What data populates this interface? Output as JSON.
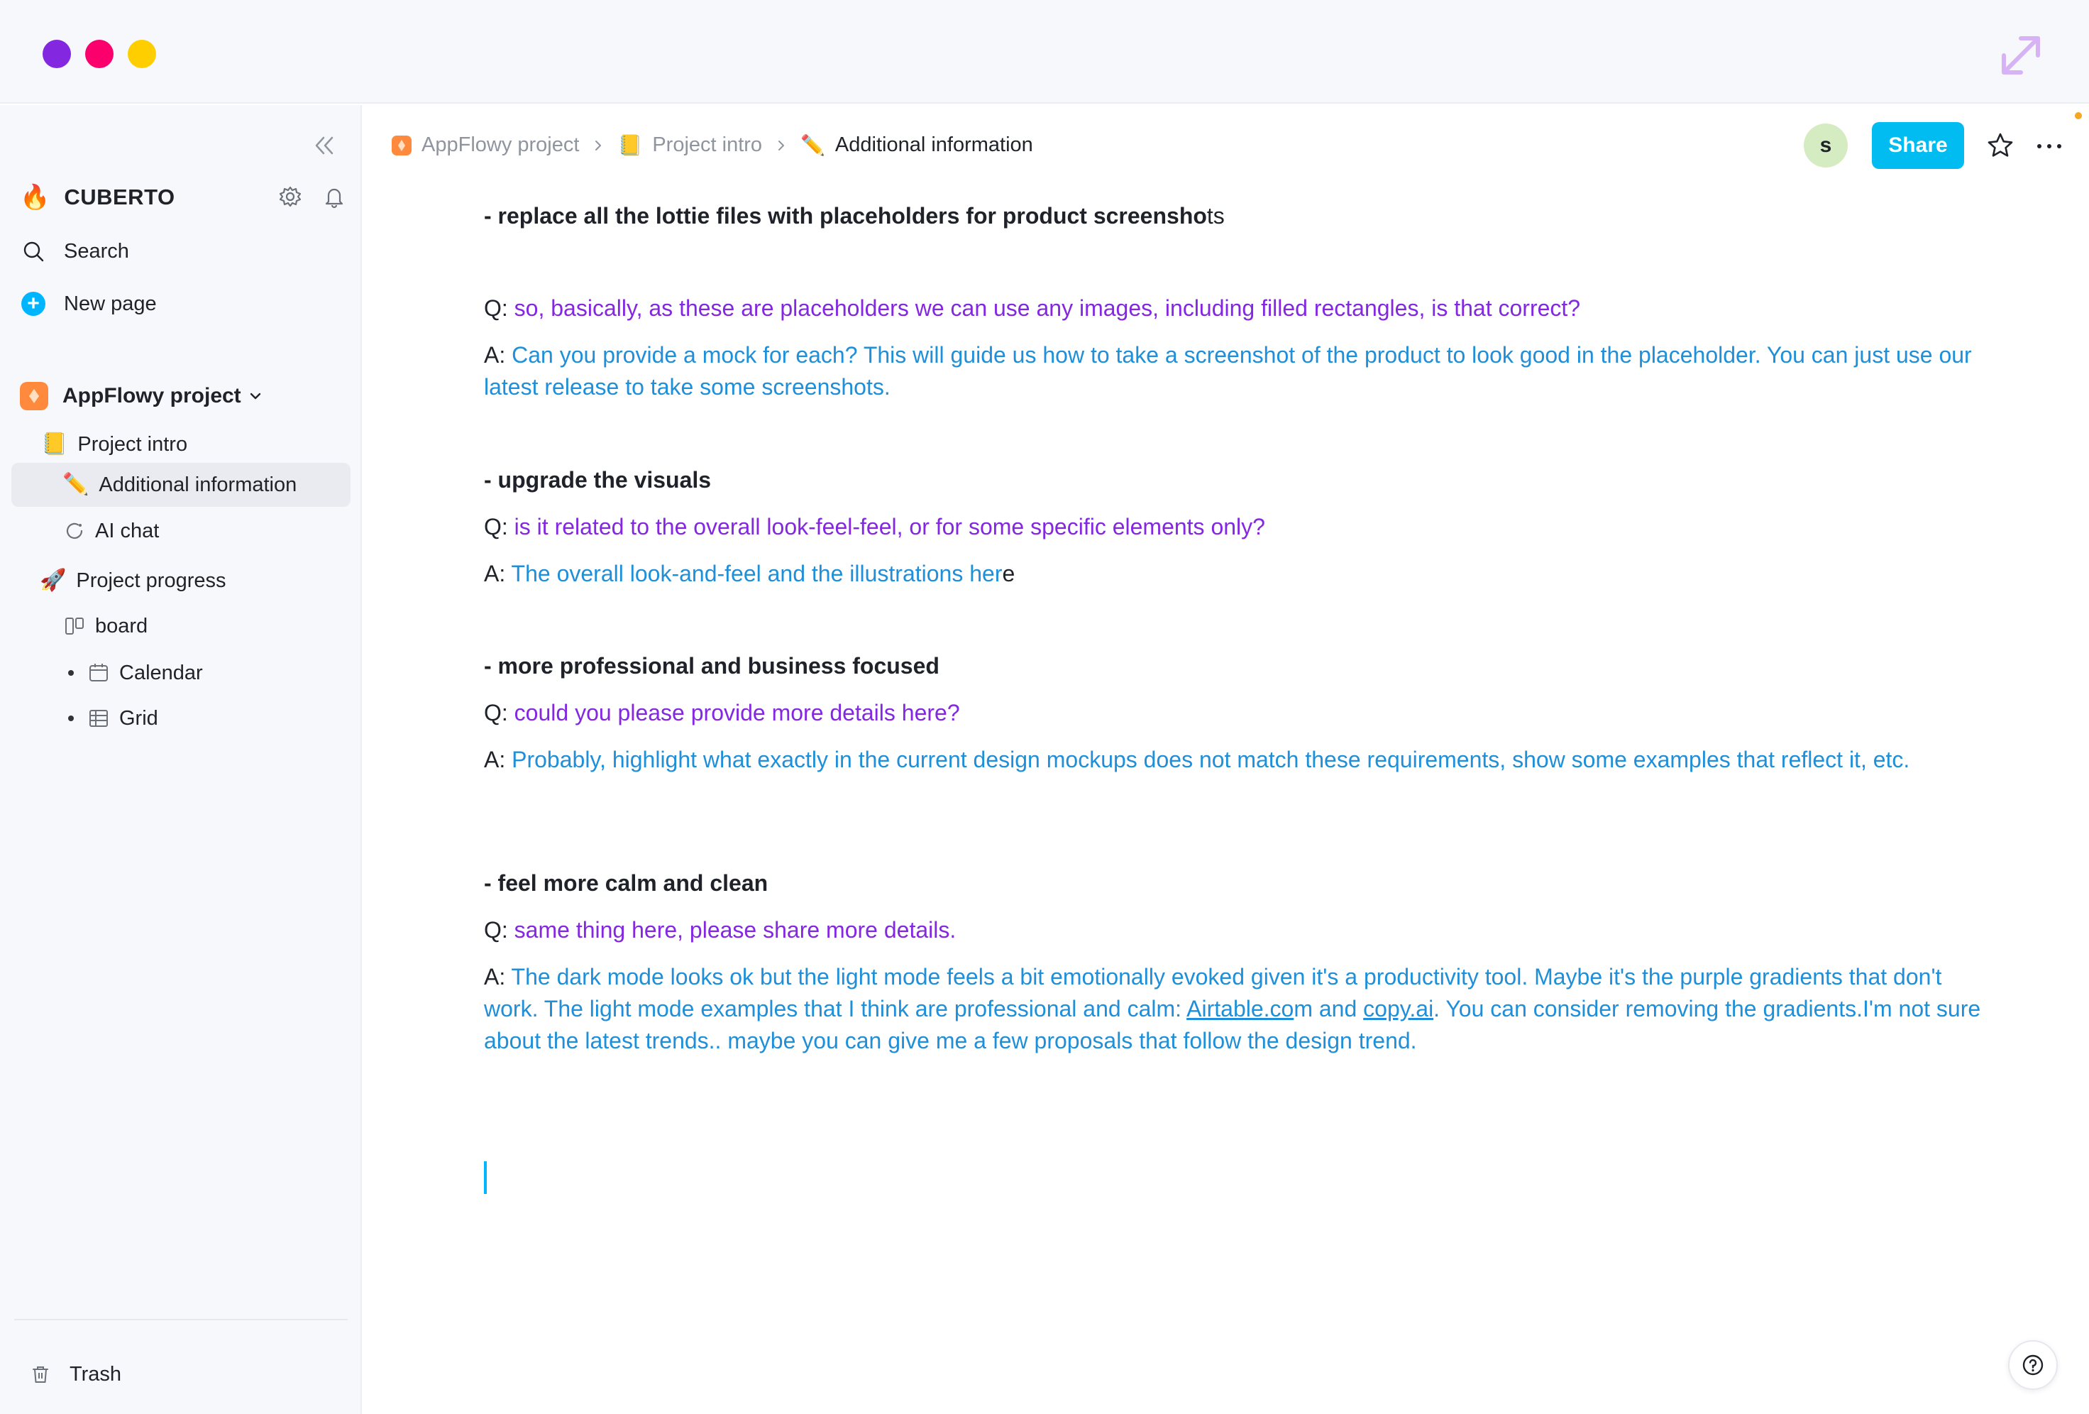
{
  "sidebar": {
    "workspace_name": "CUBERTO",
    "workspace_emoji": "🔥",
    "search_label": "Search",
    "new_page_label": "New page",
    "project_label": "AppFlowy project",
    "items": [
      {
        "label": "Project intro",
        "emoji": "📒"
      },
      {
        "label": "Additional information",
        "emoji": "✏️"
      },
      {
        "label": "AI chat"
      },
      {
        "label": "Project progress",
        "emoji": "🚀"
      },
      {
        "label": "board"
      },
      {
        "label": "Calendar"
      },
      {
        "label": "Grid"
      }
    ],
    "trash_label": "Trash"
  },
  "header": {
    "breadcrumb": [
      "AppFlowy project",
      "Project intro",
      "Additional information"
    ],
    "avatar_initial": "s",
    "share_label": "Share"
  },
  "doc": {
    "s1_heading_main": "- replace all the lottie files with placeholders for product screensho",
    "s1_heading_tail": "ts",
    "s1_q_prefix": "Q: ",
    "s1_q": "so, basically, as these are placeholders we can use any images, including filled rectangles, is that correct?",
    "s1_a_prefix": "A: ",
    "s1_a": "Can you provide a mock for each? This will guide us how to take a screenshot of the product to look good in the placeholder. You can just use our latest release to take some screenshots.",
    "s2_heading": "- upgrade the visuals",
    "s2_q_prefix": "Q: ",
    "s2_q": "is it related to the overall look-feel-feel, or for some specific elements only?",
    "s2_a_prefix": "A: ",
    "s2_a": "The overall look-and-feel and the illustrations her",
    "s2_a_tail": "e",
    "s3_heading": "- more professional and business focused",
    "s3_q_prefix": "Q: ",
    "s3_q": "could you please provide more details here?",
    "s3_a_prefix": "A: ",
    "s3_a": "Probably, highlight what exactly in the current design mockups does not match these requirements, show some examples that reflect it, etc.",
    "s4_heading": "- feel more calm and clean",
    "s4_q_prefix": "Q: ",
    "s4_q": "same thing here, please share more details.",
    "s4_a_prefix": "A: ",
    "s4_a_part1": "The dark mode looks ok but the light mode feels a bit emotionally evoked given it's a productivity tool. Maybe it's the purple gradients that don't work. The light mode examples that I think are professional and calm: ",
    "s4_link1": "Airtable.co",
    "s4_a_part2": "m and ",
    "s4_link2": "copy.ai",
    "s4_a_part3": ". You can consider removing the gradients.I'm not sure about the latest trends.. maybe you can give me a few proposals that follow the design trend."
  },
  "colors": {
    "question": "#8427e0",
    "answer": "#1e8fd8",
    "accent": "#00bcf0",
    "close": "#8427e0",
    "minimize": "#fb006d",
    "maximize": "#ffce00"
  }
}
